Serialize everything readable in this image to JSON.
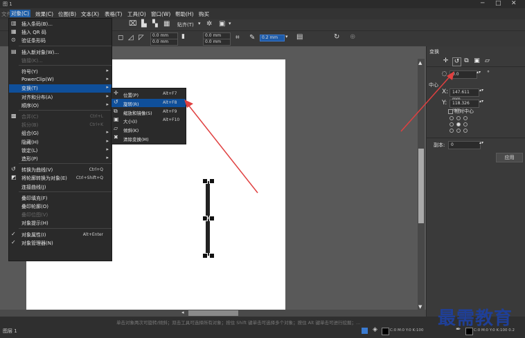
{
  "window": {
    "title": "图 1",
    "controls": [
      "─",
      "□",
      "✕"
    ]
  },
  "menubar": {
    "items": [
      "文件(F)",
      "对象(C)",
      "效果(C)",
      "位图(B)",
      "文本(X)",
      "表格(T)",
      "工具(O)",
      "窗口(W)",
      "帮助(H)",
      "购买"
    ],
    "active_index": 1
  },
  "toolbar": {
    "snap_label": "贴齐(T)",
    "width_value": "0.0 mm",
    "height_value": "0.0 mm",
    "pos1": "0.0 mm",
    "pos2": "0.0 mm",
    "outline_value": "0.2 mm"
  },
  "object_menu": {
    "items": [
      {
        "label": "插入条码(B)...",
        "icon": "barcode-icon",
        "shortcut": "",
        "arrow": false,
        "disabled": false
      },
      {
        "label": "插入 QR 码",
        "icon": "qr-icon",
        "shortcut": "",
        "arrow": false,
        "disabled": false
      },
      {
        "label": "验证条形码",
        "icon": "verify-icon",
        "shortcut": "",
        "arrow": false,
        "disabled": false
      },
      {
        "label": "插入新对象(W)...",
        "icon": "insert-object-icon",
        "shortcut": "",
        "arrow": false,
        "disabled": false
      },
      {
        "label": "链接(K)...",
        "icon": "",
        "shortcut": "",
        "arrow": false,
        "disabled": true
      },
      {
        "label": "符号(Y)",
        "icon": "",
        "shortcut": "",
        "arrow": true,
        "disabled": false
      },
      {
        "label": "PowerClip(W)",
        "icon": "",
        "shortcut": "",
        "arrow": true,
        "disabled": false
      },
      {
        "label": "变换(T)",
        "icon": "",
        "shortcut": "",
        "arrow": true,
        "disabled": false,
        "highlight": true
      },
      {
        "label": "对齐和分布(A)",
        "icon": "",
        "shortcut": "",
        "arrow": true,
        "disabled": false
      },
      {
        "label": "顺序(O)",
        "icon": "",
        "shortcut": "",
        "arrow": true,
        "disabled": false
      },
      {
        "label": "合并(C)",
        "icon": "combine-icon",
        "shortcut": "Ctrl+L",
        "arrow": false,
        "disabled": true
      },
      {
        "label": "拆分(B)",
        "icon": "",
        "shortcut": "Ctrl+K",
        "arrow": false,
        "disabled": true
      },
      {
        "label": "组合(G)",
        "icon": "",
        "shortcut": "",
        "arrow": true,
        "disabled": false
      },
      {
        "label": "隐藏(H)",
        "icon": "",
        "shortcut": "",
        "arrow": true,
        "disabled": false
      },
      {
        "label": "锁定(L)",
        "icon": "",
        "shortcut": "",
        "arrow": true,
        "disabled": false
      },
      {
        "label": "造形(P)",
        "icon": "",
        "shortcut": "",
        "arrow": true,
        "disabled": false
      },
      {
        "label": "转换为曲线(V)",
        "icon": "curve-icon",
        "shortcut": "Ctrl+Q",
        "arrow": false,
        "disabled": false
      },
      {
        "label": "将轮廓转换为对象(E)",
        "icon": "outline-object-icon",
        "shortcut": "Ctrl+Shift+Q",
        "arrow": false,
        "disabled": false
      },
      {
        "label": "连接曲线(J)",
        "icon": "",
        "shortcut": "",
        "arrow": false,
        "disabled": false
      },
      {
        "label": "叠印填充(F)",
        "icon": "",
        "shortcut": "",
        "arrow": false,
        "disabled": false
      },
      {
        "label": "叠印轮廓(O)",
        "icon": "",
        "shortcut": "",
        "arrow": false,
        "disabled": false
      },
      {
        "label": "叠印位图(V)",
        "icon": "",
        "shortcut": "",
        "arrow": false,
        "disabled": true
      },
      {
        "label": "对象提示(H)",
        "icon": "",
        "shortcut": "",
        "arrow": false,
        "disabled": false
      },
      {
        "label": "对象属性(I)",
        "icon": "check-icon",
        "shortcut": "Alt+Enter",
        "arrow": false,
        "disabled": false
      },
      {
        "label": "对象管理器(N)",
        "icon": "check-icon",
        "shortcut": "",
        "arrow": false,
        "disabled": false
      }
    ]
  },
  "transform_menu": {
    "items": [
      {
        "label": "位置(P)",
        "icon": "position-icon",
        "shortcut": "Alt+F7"
      },
      {
        "label": "旋转(R)",
        "icon": "rotate-icon",
        "shortcut": "Alt+F8",
        "highlight": true
      },
      {
        "label": "缩放和镜像(S)",
        "icon": "scale-icon",
        "shortcut": "Alt+F9"
      },
      {
        "label": "大小(I)",
        "icon": "size-icon",
        "shortcut": "Alt+F10"
      },
      {
        "label": "倾斜(K)",
        "icon": "skew-icon",
        "shortcut": ""
      },
      {
        "label": "清除变换(M)",
        "icon": "clear-transform-icon",
        "shortcut": ""
      }
    ]
  },
  "docker": {
    "title": "变换",
    "angle_value": "0.0",
    "angle_unit": "°",
    "center_label": "中心",
    "x_label": "X:",
    "x_value": "147.611 mm",
    "y_label": "Y:",
    "y_value": "118.326 mm",
    "relative_center": "相对中心",
    "copies_label": "副本:",
    "copies_value": "0",
    "apply_label": "应用"
  },
  "statusbar": {
    "hint": "单击对象两次可旋转/倾斜；双击工具可选择所有对象；按住 Shift 键单击可选择多个对象；按住 Alt 键单击可进行挖掘；...",
    "layer": "图层 1",
    "fill_info": "C:0 M:0 Y:0 K:100",
    "outline_info": "C:0 M:0 Y:0 K:100 0.2"
  },
  "watermark": "最需教育",
  "colors": {
    "accent": "#0f4f9a",
    "arrow": "#e04040",
    "watermark": "#1f3f97"
  }
}
